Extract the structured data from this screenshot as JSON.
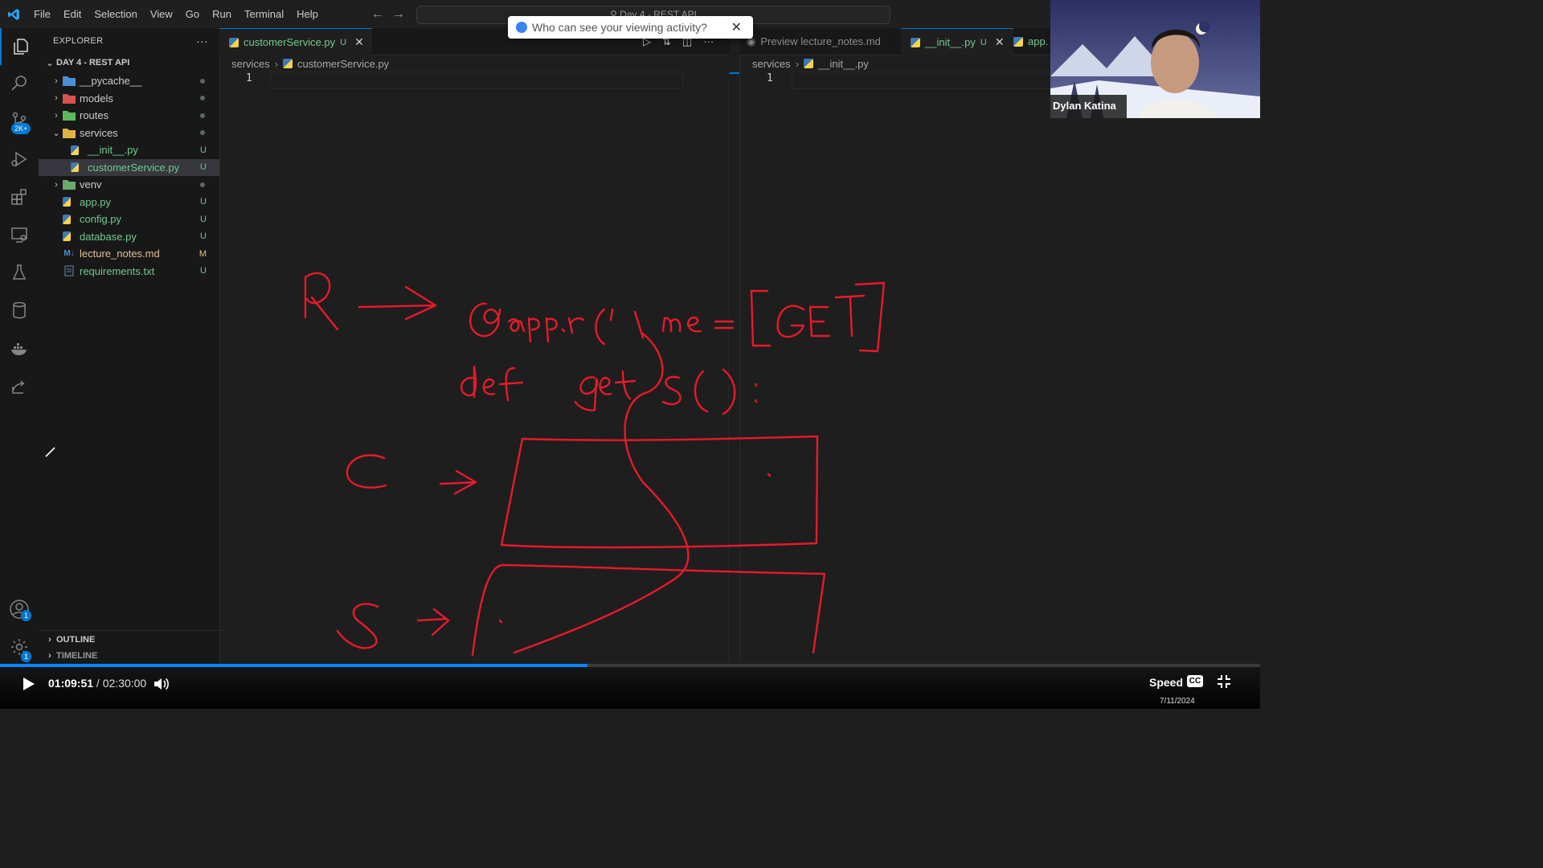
{
  "menu": [
    "File",
    "Edit",
    "Selection",
    "View",
    "Go",
    "Run",
    "Terminal",
    "Help"
  ],
  "command_center": "Day 4 - REST API",
  "popup": {
    "text": "Who can see your viewing activity?"
  },
  "activity_badges": {
    "source_control": "2K+",
    "accounts": "1",
    "manage": "1"
  },
  "sidebar": {
    "title": "EXPLORER",
    "folder": "DAY 4 - REST API",
    "items": [
      {
        "label": "__pycache__",
        "status": ""
      },
      {
        "label": "models",
        "status": ""
      },
      {
        "label": "routes",
        "status": ""
      },
      {
        "label": "services",
        "status": ""
      },
      {
        "label": "__init__.py",
        "status": "U"
      },
      {
        "label": "customerService.py",
        "status": "U"
      },
      {
        "label": "venv",
        "status": ""
      },
      {
        "label": "app.py",
        "status": "U"
      },
      {
        "label": "config.py",
        "status": "U"
      },
      {
        "label": "database.py",
        "status": "U"
      },
      {
        "label": "lecture_notes.md",
        "status": "M"
      },
      {
        "label": "requirements.txt",
        "status": "U"
      }
    ],
    "outline": "OUTLINE",
    "timeline": "TIMELINE"
  },
  "tabs_left": [
    {
      "label": "customerService.py",
      "status": "U"
    }
  ],
  "tabs_right": [
    {
      "label": "Preview lecture_notes.md"
    },
    {
      "label": "__init__.py",
      "status": "U"
    },
    {
      "label": "app."
    }
  ],
  "left_editor": {
    "crumb_folder": "services",
    "crumb_file": "customerService.py",
    "line": "1"
  },
  "right_editor": {
    "crumb_folder": "services",
    "crumb_file": "__init__.py",
    "line": "1"
  },
  "webcam": {
    "name": "Dylan Katina"
  },
  "player": {
    "current": "01:09:51",
    "separator": " / ",
    "duration": "02:30:00",
    "progress": 0.4661,
    "speed_label": "Speed",
    "cc": "CC",
    "date": "7/11/2024"
  },
  "colors": {
    "accent": "#0078d4",
    "ink": "#e8192c",
    "untracked": "#73c991",
    "modified": "#e2c08d"
  }
}
